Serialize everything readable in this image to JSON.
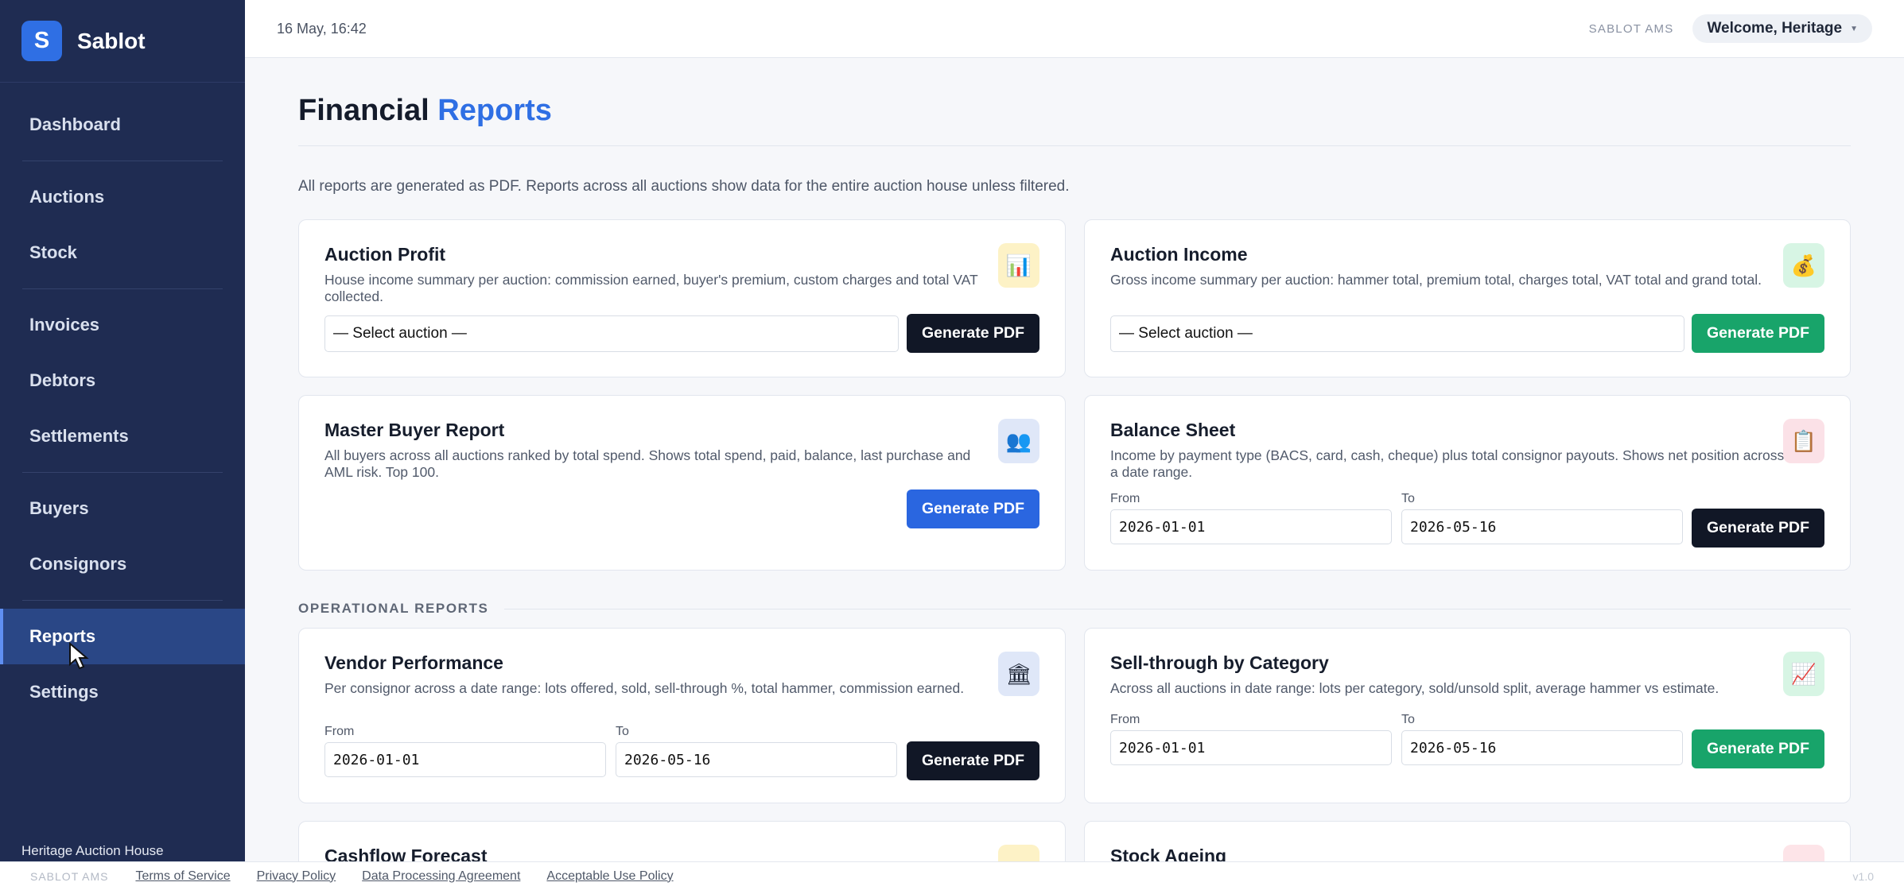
{
  "brand": {
    "logo_letter": "S",
    "name": "Sablot"
  },
  "sidebar": {
    "items": [
      {
        "label": "Dashboard"
      },
      {
        "label": "Auctions"
      },
      {
        "label": "Stock"
      },
      {
        "label": "Invoices"
      },
      {
        "label": "Debtors"
      },
      {
        "label": "Settlements"
      },
      {
        "label": "Buyers"
      },
      {
        "label": "Consignors"
      },
      {
        "label": "Reports",
        "active": true
      },
      {
        "label": "Settings"
      }
    ],
    "footer_org": "Heritage Auction House"
  },
  "topbar": {
    "datetime": "16 May, 16:42",
    "app_label": "SABLOT AMS",
    "welcome": "Welcome, Heritage"
  },
  "page": {
    "title_main": "Financial",
    "title_accent": "Reports",
    "intro": "All reports are generated as PDF. Reports across all auctions show data for the entire auction house unless filtered.",
    "operational_label": "OPERATIONAL REPORTS"
  },
  "cards": {
    "auction_profit": {
      "title": "Auction Profit",
      "desc": "House income summary per auction: commission earned, buyer's premium, custom charges and total VAT collected.",
      "select": "— Select auction —",
      "button": "Generate PDF",
      "icon": "bar-chart-icon"
    },
    "auction_income": {
      "title": "Auction Income",
      "desc": "Gross income summary per auction: hammer total, premium total, charges total, VAT total and grand total.",
      "select": "— Select auction —",
      "button": "Generate PDF",
      "icon": "money-bag-icon"
    },
    "master_buyer": {
      "title": "Master Buyer Report",
      "desc": "All buyers across all auctions ranked by total spend. Shows total spend, paid, balance, last purchase and AML risk. Top 100.",
      "button": "Generate PDF",
      "icon": "people-icon"
    },
    "balance_sheet": {
      "title": "Balance Sheet",
      "desc": "Income by payment type (BACS, card, cash, cheque) plus total consignor payouts. Shows net position across a date range.",
      "from_label": "From",
      "to_label": "To",
      "from": "2026-01-01",
      "to": "2026-05-16",
      "button": "Generate PDF",
      "icon": "clipboard-icon"
    },
    "vendor_performance": {
      "title": "Vendor Performance",
      "desc": "Per consignor across a date range: lots offered, sold, sell-through %, total hammer, commission earned.",
      "from_label": "From",
      "to_label": "To",
      "from": "2026-01-01",
      "to": "2026-05-16",
      "button": "Generate PDF",
      "icon": "bank-icon"
    },
    "sell_through": {
      "title": "Sell-through by Category",
      "desc": "Across all auctions in date range: lots per category, sold/unsold split, average hammer vs estimate.",
      "from_label": "From",
      "to_label": "To",
      "from": "2026-01-01",
      "to": "2026-05-16",
      "button": "Generate PDF",
      "icon": "trend-up-icon"
    },
    "cashflow": {
      "title": "Cashflow Forecast"
    },
    "stock_ageing": {
      "title": "Stock Ageing"
    }
  },
  "footer": {
    "app_label": "SABLOT AMS",
    "links": [
      "Terms of Service",
      "Privacy Policy",
      "Data Processing Agreement",
      "Acceptable Use Policy"
    ],
    "version": "v1.0"
  }
}
